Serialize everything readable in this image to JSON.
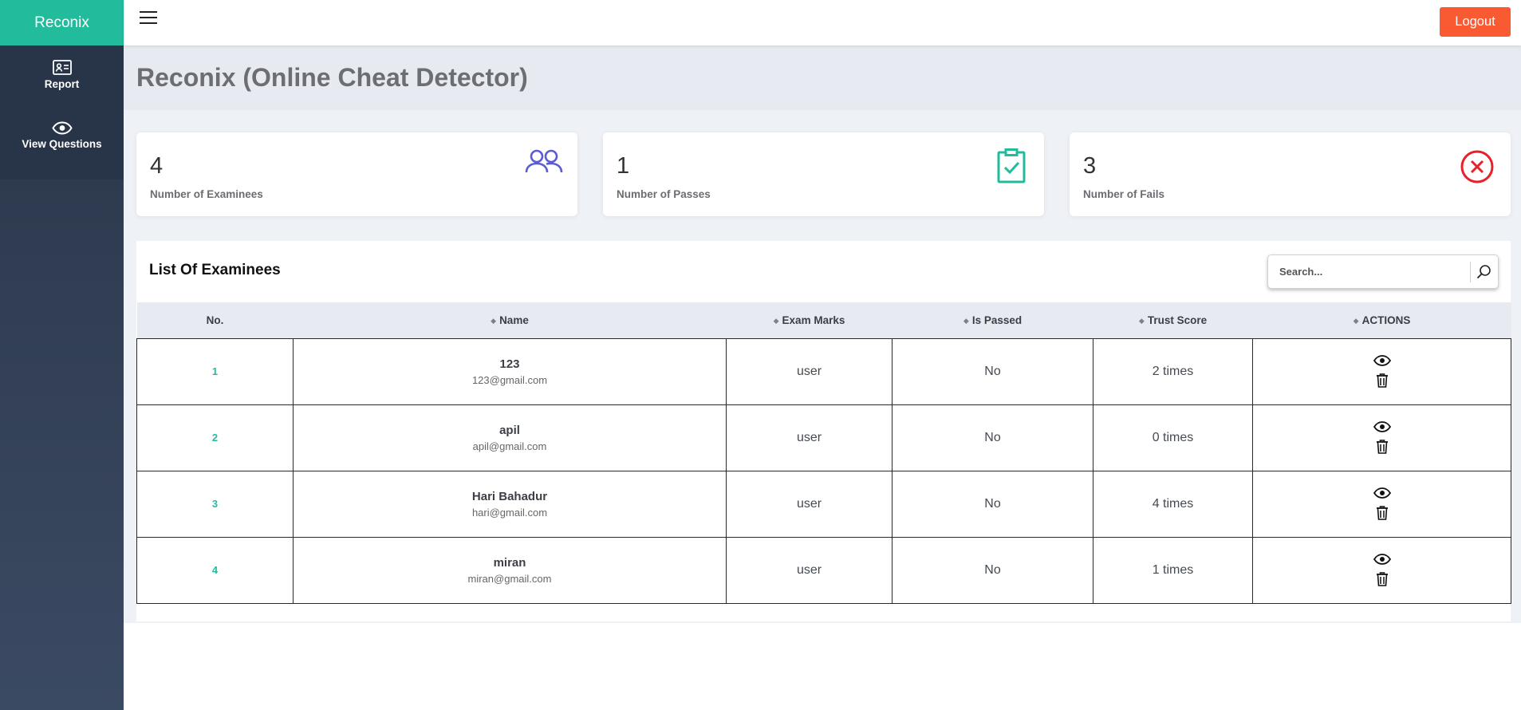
{
  "app": {
    "brand": "Reconix"
  },
  "sidebar": {
    "items": [
      {
        "label": "Report",
        "icon": "id-card-icon"
      },
      {
        "label": "View Questions",
        "icon": "eye-icon"
      }
    ]
  },
  "header": {
    "logout_label": "Logout"
  },
  "page": {
    "title": "Reconix (Online Cheat Detector)"
  },
  "stats": [
    {
      "value": "4",
      "label": "Number of Examinees",
      "icon": "users-icon",
      "color": "#5b5bd6"
    },
    {
      "value": "1",
      "label": "Number of Passes",
      "icon": "clipboard-check-icon",
      "color": "#22bc9d"
    },
    {
      "value": "3",
      "label": "Number of Fails",
      "icon": "x-circle-icon",
      "color": "#e8202a"
    }
  ],
  "examinees": {
    "title": "List Of Examinees",
    "search_placeholder": "Search...",
    "columns": [
      "No.",
      "Name",
      "Exam Marks",
      "Is Passed",
      "Trust Score",
      "ACTIONS"
    ],
    "rows": [
      {
        "no": "1",
        "name": "123",
        "email": "123@gmail.com",
        "marks": "user",
        "passed": "No",
        "trust": "2 times"
      },
      {
        "no": "2",
        "name": "apil",
        "email": "apil@gmail.com",
        "marks": "user",
        "passed": "No",
        "trust": "0 times"
      },
      {
        "no": "3",
        "name": "Hari Bahadur",
        "email": "hari@gmail.com",
        "marks": "user",
        "passed": "No",
        "trust": "4 times"
      },
      {
        "no": "4",
        "name": "miran",
        "email": "miran@gmail.com",
        "marks": "user",
        "passed": "No",
        "trust": "1 times"
      }
    ]
  },
  "colors": {
    "brand": "#22bc9d",
    "sidebar": "#2a3548",
    "logout": "#fa5a32"
  }
}
